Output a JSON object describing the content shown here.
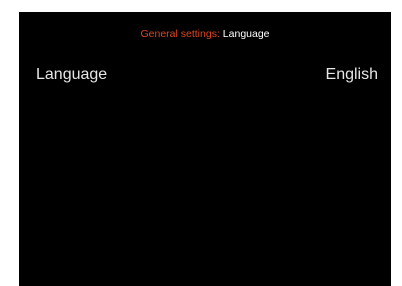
{
  "header": {
    "section": "General settings:",
    "page": "Language"
  },
  "setting": {
    "label": "Language",
    "value": "English"
  },
  "colors": {
    "background": "#000000",
    "accent": "#d9471f",
    "text": "#ffffff"
  }
}
